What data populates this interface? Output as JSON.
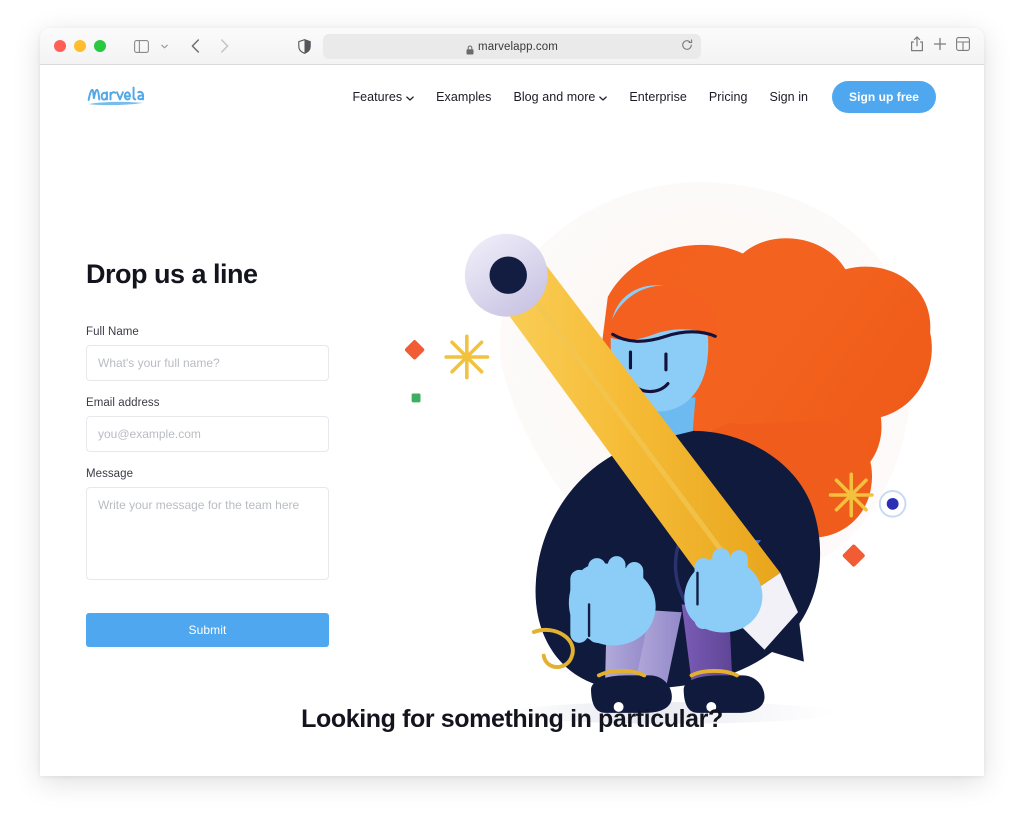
{
  "browser": {
    "traffic_lights": [
      "close",
      "minimize",
      "maximize"
    ],
    "sidebar_toggle_label": "Show sidebar",
    "tab_overview_label": "Tab overview",
    "back_label": "Back",
    "forward_label": "Forward",
    "url": "marvelapp.com",
    "reload_label": "Reload",
    "share_label": "Share",
    "new_tab_label": "New tab",
    "privacy_report_label": "Privacy report"
  },
  "nav": {
    "logo_text": "Marvel",
    "links": [
      {
        "label": "Features",
        "has_dropdown": true
      },
      {
        "label": "Examples",
        "has_dropdown": false
      },
      {
        "label": "Blog and more",
        "has_dropdown": true
      },
      {
        "label": "Enterprise",
        "has_dropdown": false
      },
      {
        "label": "Pricing",
        "has_dropdown": false
      },
      {
        "label": "Sign in",
        "has_dropdown": false
      }
    ],
    "signup_label": "Sign up free"
  },
  "form": {
    "heading": "Drop us a line",
    "fields": [
      {
        "label": "Full Name",
        "placeholder": "What's your full name?",
        "value": ""
      },
      {
        "label": "Email address",
        "placeholder": "you@example.com",
        "value": ""
      },
      {
        "label": "Message",
        "placeholder": "Write your message for the team here",
        "value": ""
      }
    ],
    "submit_label": "Submit"
  },
  "bottom": {
    "heading": "Looking for something in particular?"
  },
  "colors": {
    "accent_blue": "#4fa8ef",
    "hair_orange": "#f4601f",
    "jacket_navy": "#121c3e",
    "skin_blue": "#7dc8f7",
    "pencil_yellow": "#f5b731",
    "trouser_light": "#a39bd0",
    "trouser_dark": "#6f52a8",
    "eraser_lavender": "#d8d4ec",
    "text_dark": "#14141e"
  }
}
